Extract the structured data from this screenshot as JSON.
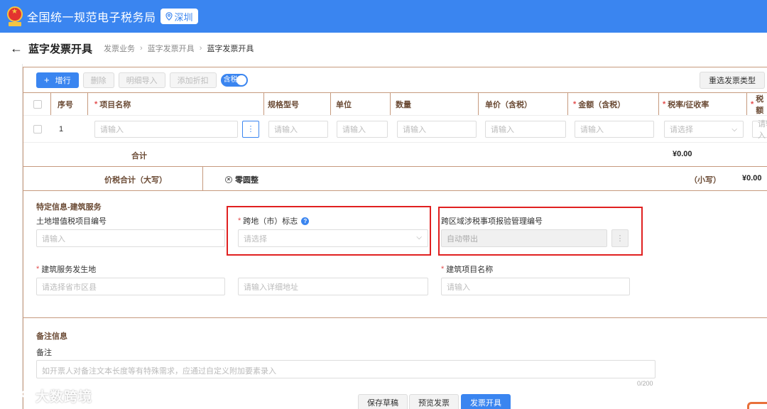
{
  "app": {
    "title": "全国统一规范电子税务局",
    "location": "深圳"
  },
  "header": {
    "page_title": "蓝字发票开具",
    "breadcrumbs": [
      "发票业务",
      "蓝字发票开具",
      "蓝字发票开具"
    ]
  },
  "toolbar": {
    "add_label": "增行",
    "delete_label": "删除",
    "import_label": "明细导入",
    "discount_label": "添加折扣",
    "tax_toggle_label": "含税",
    "tax_toggle_on": true,
    "reselect_label": "重选发票类型"
  },
  "table": {
    "headers": {
      "seq": "序号",
      "name": "项目名称",
      "spec": "规格型号",
      "unit": "单位",
      "qty": "数量",
      "price": "单价（含税）",
      "amount": "金额（含税）",
      "rate": "税率/征收率",
      "tax": "税额"
    },
    "row": {
      "seq": "1",
      "placeholder": "请输入",
      "select_placeholder": "请选择",
      "more_label": "⋮"
    },
    "subtotal_label": "合计",
    "subtotal_value": "¥0.00",
    "total_label": "价税合计（大写）",
    "total_zero": "零圆整",
    "total_small_label": "（小写）",
    "total_small_value": "¥0.00"
  },
  "special": {
    "section_title": "特定信息-建筑服务",
    "land_tax_label": "土地增值税项目编号",
    "land_tax_placeholder": "请输入",
    "cross_region_label": "跨地（市）标志",
    "cross_region_placeholder": "请选择",
    "report_no_label": "跨区域涉税事项报验管理编号",
    "report_no_value": "自动带出",
    "service_place_label": "建筑服务发生地",
    "service_place_placeholder": "请选择省市区县",
    "address_placeholder": "请输入详细地址",
    "project_name_label": "建筑项目名称",
    "project_name_placeholder": "请输入"
  },
  "remarks": {
    "section_title": "备注信息",
    "label": "备注",
    "placeholder": "如开票人对备注文本长度等有特殊需求，应通过自定义附加要素录入",
    "counter": "0/200"
  },
  "footer": {
    "save_draft": "保存草稿",
    "preview": "预览发票",
    "issue": "发票开具"
  },
  "watermark": {
    "text": "大数跨境"
  },
  "colors": {
    "primary": "#3a85f0",
    "border_brown": "#c69a7e",
    "highlight_red": "#e02020"
  }
}
